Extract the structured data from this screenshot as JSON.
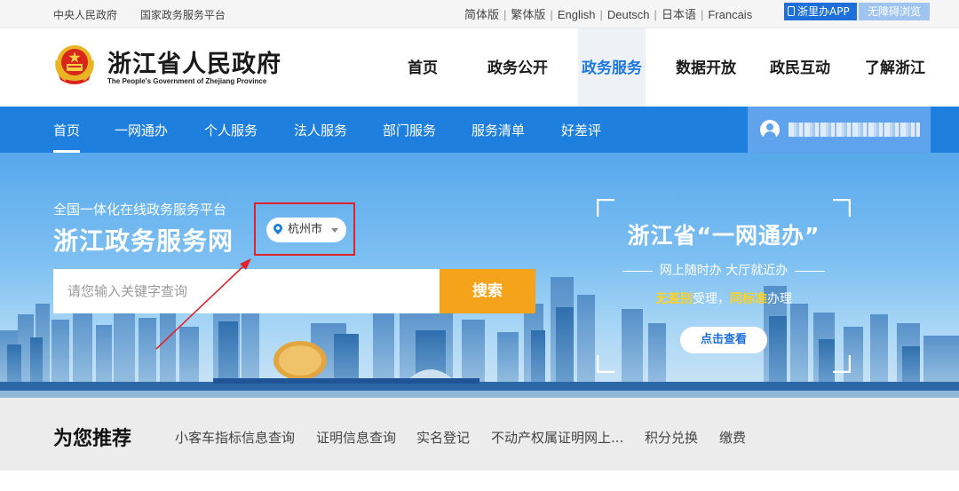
{
  "topbar": {
    "left_links": [
      "中央人民政府",
      "国家政务服务平台"
    ],
    "languages": [
      "简体版",
      "繁体版",
      "English",
      "Deutsch",
      "日本语",
      "Francais"
    ],
    "app_button": "浙里办APP",
    "accessibility_button": "无障碍浏览"
  },
  "header": {
    "brand_cn": "浙江省人民政府",
    "brand_en": "The People's Government of Zhejiang Province",
    "nav": [
      "首页",
      "政务公开",
      "政务服务",
      "数据开放",
      "政民互动",
      "了解浙江"
    ],
    "active_nav": "政务服务"
  },
  "subnav": {
    "items": [
      "首页",
      "一网通办",
      "个人服务",
      "法人服务",
      "部门服务",
      "服务清单",
      "好差评"
    ],
    "active": "首页"
  },
  "hero": {
    "subtitle": "全国一体化在线政务服务平台",
    "title": "浙江政务服务网",
    "city": "杭州市",
    "search_placeholder": "请您输入关键字查询",
    "search_button": "搜索"
  },
  "promo": {
    "title": "浙江省“一网通办”",
    "subtitle": "网上随时办 大厅就近办",
    "slogan_hl1": "无差别",
    "slogan_mid": "受理",
    "slogan_hl2": "同标准",
    "slogan_end": "办理",
    "button": "点击查看"
  },
  "recommend": {
    "title": "为您推荐",
    "links": [
      "小客车指标信息查询",
      "证明信息查询",
      "实名登记",
      "不动产权属证明网上...",
      "积分兑换",
      "缴费"
    ]
  },
  "colors": {
    "primary_blue": "#1f7fdf",
    "search_orange": "#f5a31a",
    "highlight_red": "#e0222b",
    "slogan_yellow": "#ffd21f"
  }
}
